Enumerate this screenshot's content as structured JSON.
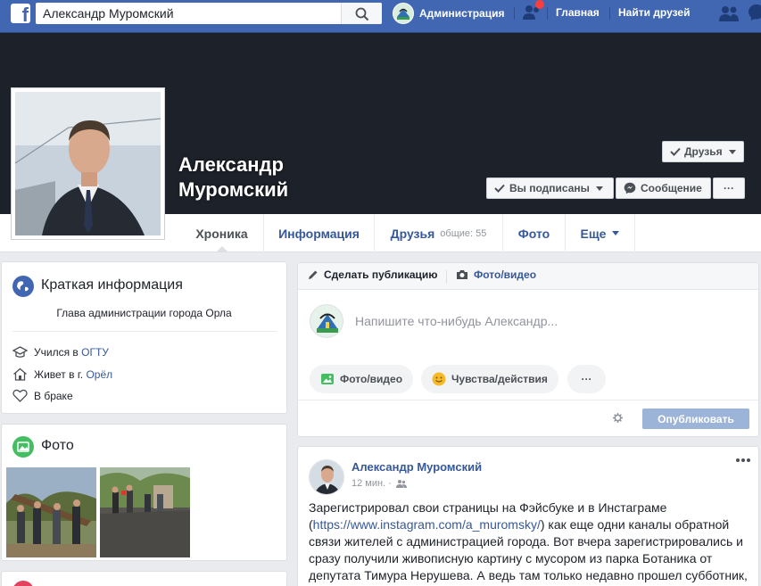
{
  "topbar": {
    "logo": "f",
    "search_value": "Александр Муромский",
    "search_icon": "search-icon",
    "profile_name": "Администрация",
    "nav": [
      "Главная",
      "Найти друзей"
    ],
    "colors": {
      "bar": "#4267b2",
      "notification": "#fa3e3e"
    }
  },
  "profile": {
    "name_line1": "Александр",
    "name_line2": "Муромский",
    "friends_button": "Друзья",
    "subscribed_button": "Вы подписаны",
    "message_button": "Сообщение",
    "more_button": "···"
  },
  "tabs": {
    "timeline": "Хроника",
    "about": "Информация",
    "friends": "Друзья",
    "friends_mutual": "общие: 55",
    "photos": "Фото",
    "more": "Еще"
  },
  "intro": {
    "title": "Краткая информация",
    "bio": "Глава администрации города Орла",
    "studied_prefix": "Учился в",
    "studied_link": "ОГТУ",
    "lives_prefix": "Живет в г.",
    "lives_link": "Орёл",
    "relationship": "В браке"
  },
  "photos_card": {
    "title": "Фото"
  },
  "composer": {
    "tab_post": "Сделать публикацию",
    "tab_media": "Фото/видео",
    "placeholder": "Напишите что-нибудь Александр...",
    "action_media": "Фото/видео",
    "action_feelings": "Чувства/действия",
    "action_more": "···",
    "publish": "Опубликовать"
  },
  "post": {
    "author": "Александр Муромский",
    "time": "12 мин. ·",
    "menu": "···",
    "line1": "Зарегистрировал свои страницы на Фэйсбуке и в Инстаграме",
    "link": "https://www.instagram.com/a_muromsky/",
    "line2_rest": ") как еще одни каналы обратной",
    "line3": "связи жителей с администрацией города. Вот вчера зарегистрировались и",
    "line4": "сразу получили живописную картину с мусором из парка Ботаника от",
    "line5": "депутата Тимура Нерушева. А ведь там только недавно прошел субботник,"
  }
}
